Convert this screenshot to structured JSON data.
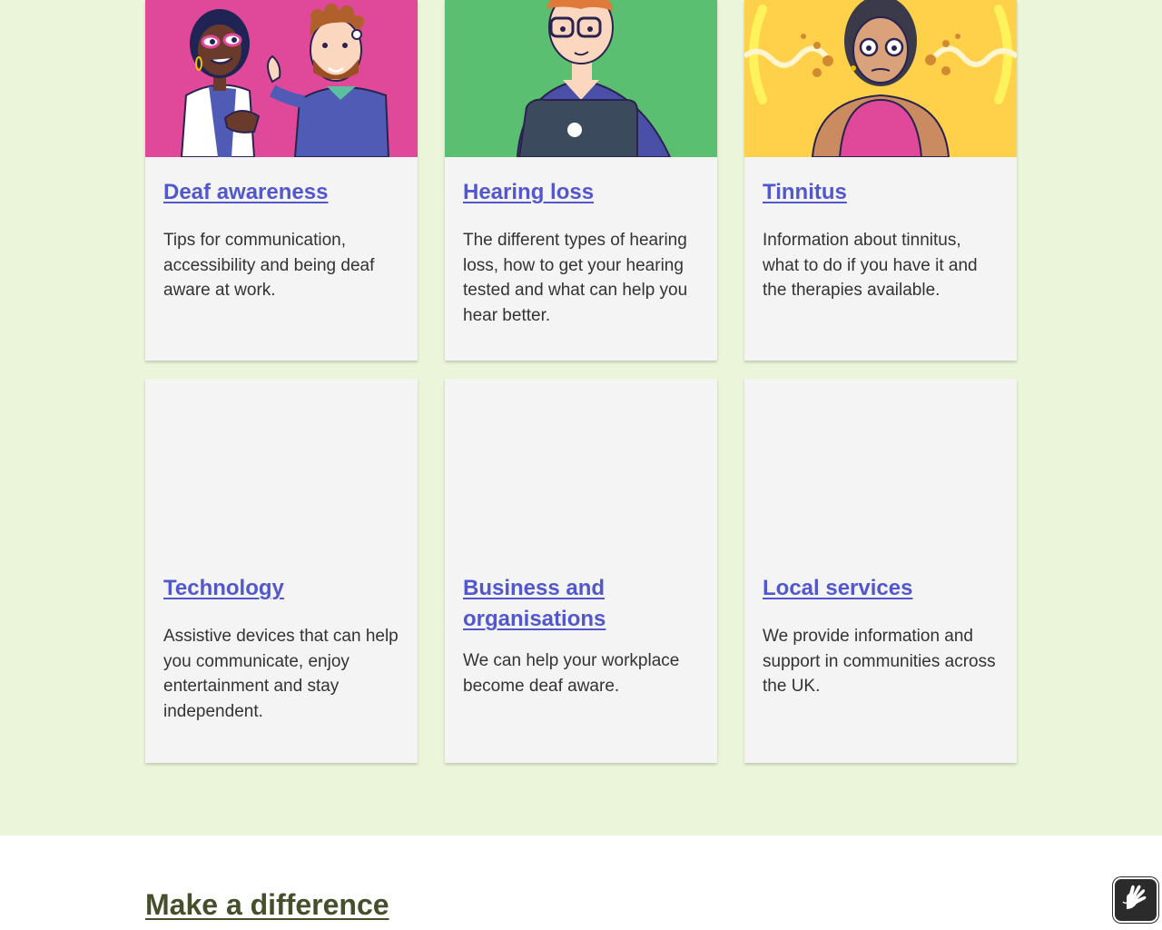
{
  "cards": [
    {
      "title": "Deaf awareness",
      "description": "Tips for communication, accessibility and being deaf aware at work.",
      "image": "two-people-thumbs-up-illustration",
      "image_bg": "#e0489a"
    },
    {
      "title": "Hearing loss",
      "description": "The different types of hearing loss, how to get your hearing tested and what can help you hear better.",
      "image": "man-with-laptop-illustration",
      "image_bg": "#5bbf72"
    },
    {
      "title": "Tinnitus",
      "description": "Information about tinnitus, what to do if you have it and the therapies available.",
      "image": "woman-with-tinnitus-illustration",
      "image_bg": "#ffd14a"
    },
    {
      "title": "Technology",
      "description": "Assistive devices that can help you communicate, enjoy entertainment and stay independent."
    },
    {
      "title": "Business and organisations",
      "description": "We can help your workplace become deaf aware."
    },
    {
      "title": "Local services",
      "description": "We provide information and support in communities across the UK."
    }
  ],
  "section": {
    "title": "Make a difference"
  },
  "sign_language_button": {
    "icon": "sign-language-icon"
  },
  "colors": {
    "band": "#ebf5d9",
    "link": "#5258cc",
    "section_link": "#454f2b"
  }
}
